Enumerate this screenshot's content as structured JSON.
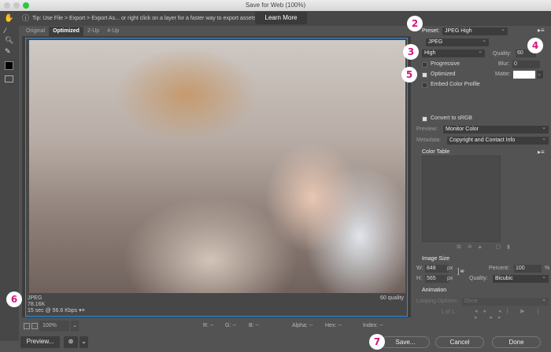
{
  "window": {
    "title": "Save for Web (100%)"
  },
  "tip": {
    "text": "Tip: Use File > Export > Export As...  or right click on a layer for a faster way to export assets",
    "learn_more": "Learn More"
  },
  "tabs": [
    {
      "label": "Original"
    },
    {
      "label": "Optimized",
      "active": true
    },
    {
      "label": "2-Up"
    },
    {
      "label": "4-Up"
    }
  ],
  "image_info": {
    "format": "JPEG",
    "size": "78.16K",
    "time": "15 sec @ 56.6 Kbps",
    "quality": "60 quality"
  },
  "status": {
    "zoom": "100%",
    "r": "R: --",
    "g": "G: --",
    "b": "B: --",
    "alpha": "Alpha: --",
    "hex": "Hex: --",
    "index": "Index: --"
  },
  "buttons": {
    "preview": "Preview...",
    "save": "Save...",
    "cancel": "Cancel",
    "done": "Done"
  },
  "settings": {
    "preset_label": "Preset:",
    "preset": "JPEG High",
    "format": "JPEG",
    "quality_level": "High",
    "quality_label": "Quality:",
    "quality": "60",
    "blur_label": "Blur:",
    "blur": "0",
    "matte_label": "Matte:",
    "progressive": {
      "label": "Progressive",
      "checked": false
    },
    "optimized": {
      "label": "Optimized",
      "checked": true
    },
    "embed": {
      "label": "Embed Color Profile",
      "checked": false
    },
    "srgb": {
      "label": "Convert to sRGB",
      "checked": true
    },
    "preview_label": "Preview:",
    "preview": "Monitor Color",
    "metadata_label": "Metadata:",
    "metadata": "Copyright and Contact Info",
    "color_table": "Color Table"
  },
  "image_size": {
    "title": "Image Size",
    "w_label": "W:",
    "w": "848",
    "h_label": "H:",
    "h": "565",
    "unit": "px",
    "percent_label": "Percent:",
    "percent": "100",
    "percent_unit": "%",
    "quality_label": "Quality:",
    "quality": "Bicubic"
  },
  "animation": {
    "title": "Animation",
    "looping_label": "Looping Options:",
    "looping": "Once",
    "frame": "1 of 1"
  },
  "markers": [
    "2",
    "3",
    "4",
    "5",
    "6",
    "7"
  ],
  "colors": {
    "accent": "#2d8ee6",
    "marker": "#d4177f"
  }
}
